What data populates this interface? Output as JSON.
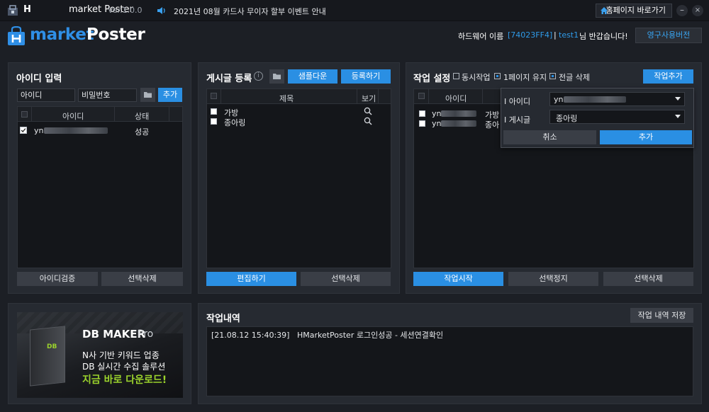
{
  "titlebar": {
    "app_name_bold": "H",
    "app_name": "market Poster",
    "version": "Ver.1.0.0",
    "notice": "2021년 08월 카드사 무이자 할부 이벤트 안내",
    "homepage_label": "홈페이지 바로가기",
    "minimize": "–",
    "close": "×"
  },
  "header": {
    "logo_market": "market",
    "logo_poster": "Poster",
    "hw_label": "하드웨어 이름",
    "hw_id": "[74023FF4]",
    "separator": "|",
    "user_id": "test1",
    "greeting": "님 반갑습니다!",
    "perm_button": "영구사용버전"
  },
  "id_panel": {
    "title": "아이디 입력",
    "id_placeholder": "아이디",
    "pw_placeholder": "비밀번호",
    "add_label": "추가",
    "col_id": "아이디",
    "col_status": "상태",
    "rows": [
      {
        "id_prefix": "yn",
        "status": "성공",
        "checked": true
      }
    ],
    "verify_button": "아이디검증",
    "delete_button": "선택삭제"
  },
  "post_panel": {
    "title": "게시글 등록",
    "sample_button": "샘플다운",
    "register_button": "등록하기",
    "col_title": "제목",
    "col_view": "보기",
    "rows": [
      {
        "title": "가방"
      },
      {
        "title": "종아링"
      }
    ],
    "edit_button": "편집하기",
    "delete_button": "선택삭제"
  },
  "task_panel": {
    "title": "작업 설정",
    "opt_simultaneous": "동시작업",
    "opt_keep_page": "1페이지 유지",
    "opt_delete_prev": "전글 삭제",
    "add_task_button": "작업추가",
    "col_id": "아이디",
    "rows": [
      {
        "id_prefix": "yn",
        "post": "가방"
      },
      {
        "id_prefix": "yn",
        "post": "종아"
      }
    ],
    "popup": {
      "id_label": "I 아이디",
      "id_value_prefix": "yn",
      "post_label": "I 게시글",
      "post_value": "종아링",
      "cancel": "취소",
      "add": "추가"
    },
    "start_button": "작업시작",
    "stop_button": "선택정지",
    "delete_button": "선택삭제"
  },
  "banner": {
    "title_db": "DB MAKER",
    "title_pro": "Pro",
    "line1": "N사 기반 키워드 업종",
    "line2": "DB 실시간 수집 솔루션",
    "cta": "지금 바로 다운로드!",
    "box_label": "DB"
  },
  "log_panel": {
    "title": "작업내역",
    "save_button": "작업 내역 저장",
    "entries": [
      "[21.08.12 15:40:39]   HMarketPoster 로그인성공 - 세션연결확인"
    ]
  },
  "colors": {
    "accent": "#2a8fe3",
    "background": "#1c1f25",
    "panel": "#262a31",
    "banner_green": "#9bd32c"
  }
}
